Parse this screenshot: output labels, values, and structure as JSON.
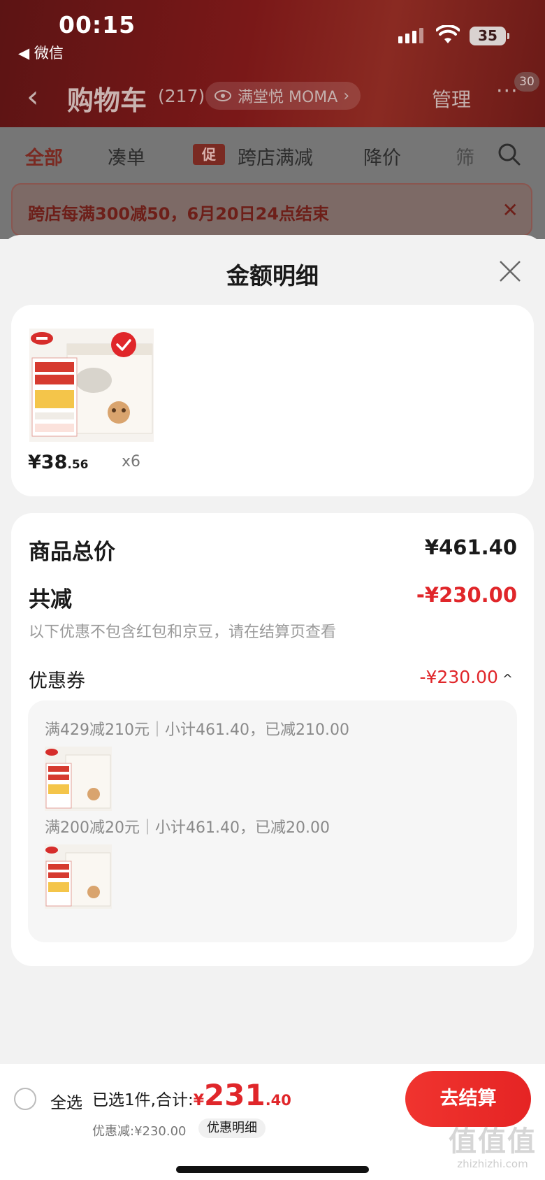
{
  "status": {
    "time": "00:15",
    "back_app": "◀ 微信",
    "battery": "35"
  },
  "nav": {
    "back_icon": "‹",
    "title": "购物车",
    "count": "(217)",
    "shop": "满堂悦 MOMA",
    "shop_chev": "›",
    "manage": "管理",
    "more": "···",
    "badge": "30"
  },
  "filters": {
    "all": "全部",
    "bundle": "凑单",
    "promo_tag": "促",
    "cross_store": "跨店满减",
    "price_drop": "降价",
    "filter_partial": "筛"
  },
  "banner": {
    "text": "跨店每满300减50，6月20日24点结束",
    "close": "✕"
  },
  "sheet": {
    "title": "金额明细",
    "product": {
      "price_main": "¥38",
      "price_cents": ".56",
      "qty": "x6"
    },
    "total_label": "商品总价",
    "total_value": "¥461.40",
    "reduce_label": "共减",
    "reduce_value": "-¥230.00",
    "hint": "以下优惠不包含红包和京豆，请在结算页查看",
    "coupon_label": "优惠券",
    "coupon_value": "-¥230.00",
    "coupon_chev": "^",
    "rules": [
      "满429减210元｜小计461.40，已减210.00",
      "满200减20元｜小计461.40，已减20.00"
    ]
  },
  "bottom": {
    "select_all": "全选",
    "selected_text": "已选1件,合计:",
    "currency": "¥",
    "total_big": "231",
    "total_small": ".40",
    "discount": "优惠减:¥230.00",
    "detail": "优惠明细",
    "checkout": "去结算"
  },
  "watermark": {
    "glyphs": "值值值",
    "url": "zhizhizhi.com"
  },
  "colors": {
    "accent": "#e0262a",
    "header_bg": "#7a1818",
    "sheet_bg": "#f2f2f2"
  }
}
